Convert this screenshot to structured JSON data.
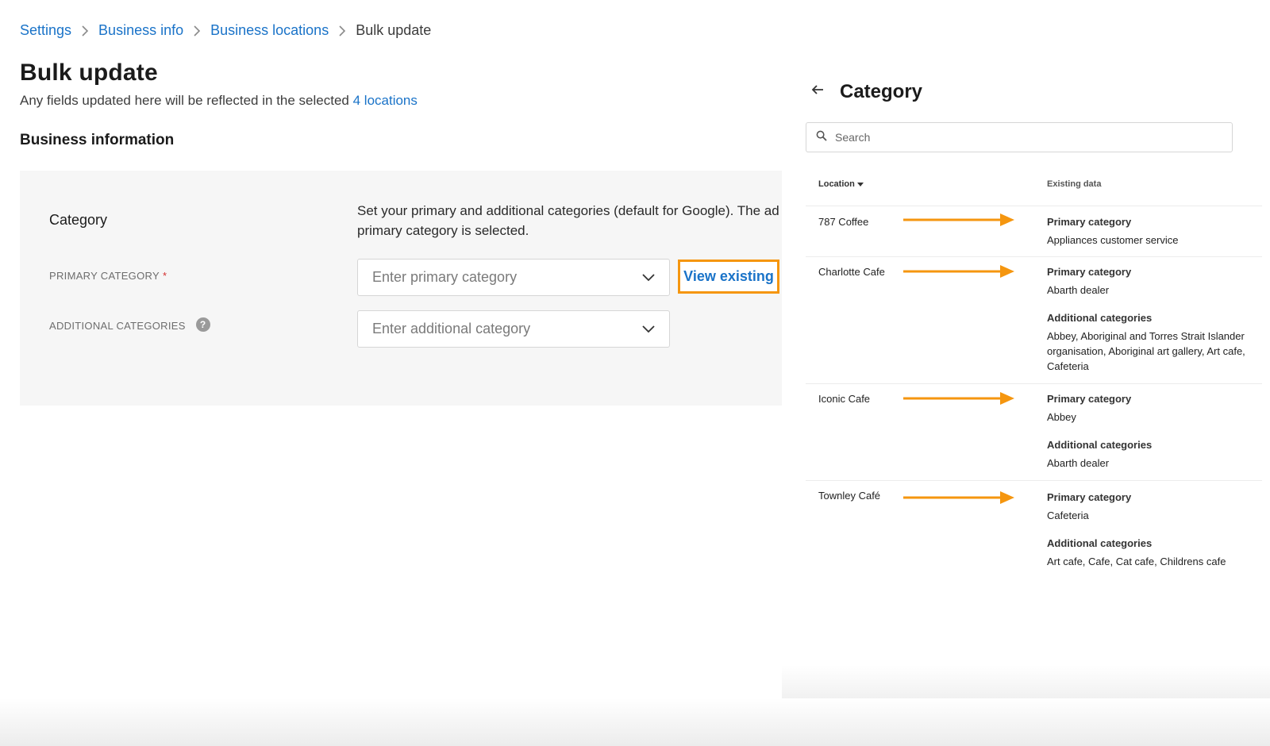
{
  "breadcrumb": {
    "items": [
      "Settings",
      "Business info",
      "Business locations"
    ],
    "current": "Bulk update"
  },
  "page": {
    "title": "Bulk update",
    "subtitle_prefix": "Any fields updated here will be reflected in the selected",
    "subtitle_link": "4 locations"
  },
  "section": {
    "title": "Business information"
  },
  "category_card": {
    "label": "Category",
    "description_line1": "Set your primary and additional categories (default for Google). The ad",
    "description_line2": "primary category is selected.",
    "primary_label": "PRIMARY CATEGORY",
    "required_mark": "*",
    "primary_placeholder": "Enter primary category",
    "additional_label": "ADDITIONAL CATEGORIES",
    "help_glyph": "?",
    "additional_placeholder": "Enter additional category",
    "view_existing_label": "View existing"
  },
  "panel": {
    "title": "Category",
    "search_placeholder": "Search",
    "column_location": "Location",
    "column_existing": "Existing data",
    "rows": [
      {
        "location": "787 Coffee",
        "primary_title": "Primary category",
        "primary_value": "Appliances customer service"
      },
      {
        "location": "Charlotte Cafe",
        "primary_title": "Primary category",
        "primary_value": "Abarth dealer",
        "additional_title": "Additional categories",
        "additional_value": "Abbey, Aboriginal and Torres Strait Islander organisation, Aboriginal art gallery, Art cafe, Cafeteria"
      },
      {
        "location": "Iconic Cafe",
        "primary_title": "Primary category",
        "primary_value": "Abbey",
        "additional_title": "Additional categories",
        "additional_value": "Abarth dealer"
      },
      {
        "location": "Townley Café",
        "primary_title": "Primary category",
        "primary_value": "Cafeteria",
        "additional_title": "Additional categories",
        "additional_value": "Art cafe, Cafe, Cat cafe, Childrens cafe"
      }
    ]
  },
  "colors": {
    "link": "#1a73c8",
    "highlight_orange": "#f5960f",
    "required_red": "#d32f2f",
    "card_background": "#f6f6f6"
  },
  "icons": {
    "breadcrumb_separator": "chevron-right-icon",
    "select_chevron": "chevron-down-icon",
    "help": "question-circle-icon",
    "back": "arrow-left-icon",
    "search": "search-icon",
    "sort": "caret-down-icon",
    "row_pointer": "orange-arrow-right-icon"
  }
}
